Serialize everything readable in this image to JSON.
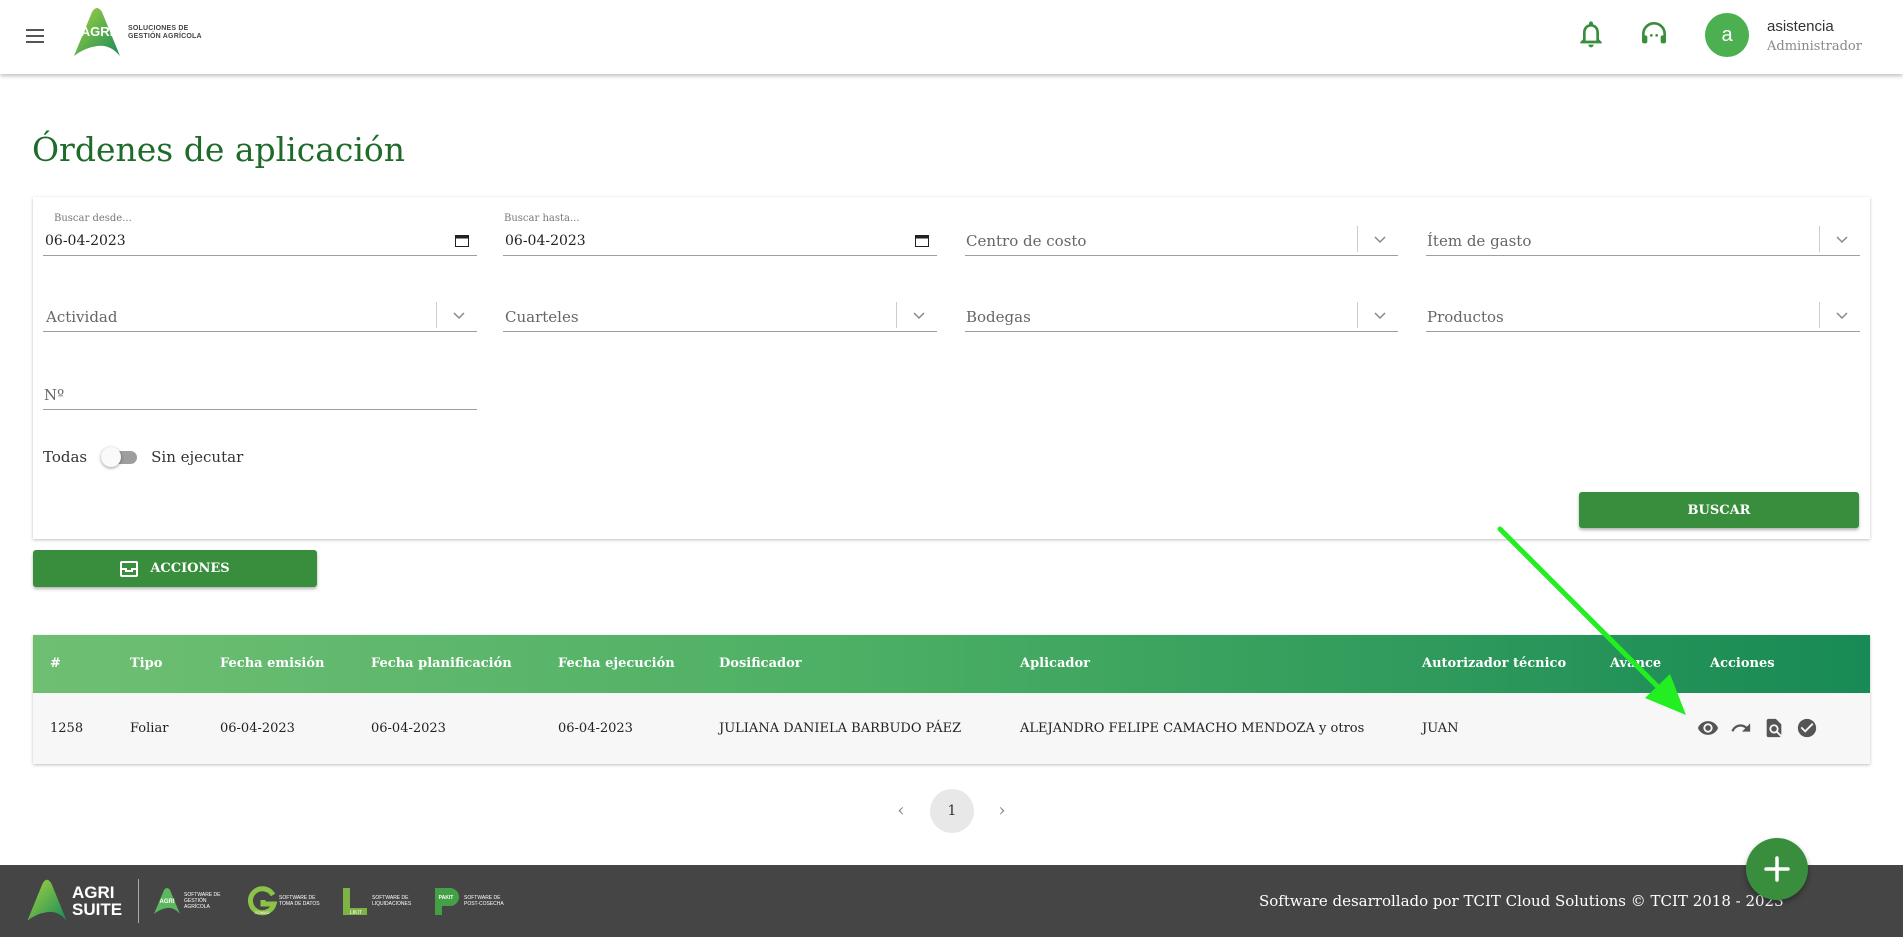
{
  "header": {
    "logo_text": "SOLUCIONES DE GESTIÓN AGRÍCOLA",
    "logo_word": "AGRI",
    "user_initial": "a",
    "user_name": "asistencia",
    "user_role": "Administrador",
    "icons": [
      "menu-icon",
      "bell-icon",
      "support-headset-icon"
    ]
  },
  "page": {
    "title": "Órdenes de aplicación"
  },
  "filters": {
    "desde": {
      "label": "Buscar desde...",
      "value": "06-04-2023"
    },
    "hasta": {
      "label": "Buscar hasta...",
      "value": "06-04-2023"
    },
    "centro_costo": "Centro de costo",
    "item_gasto": "Ítem de gasto",
    "actividad": "Actividad",
    "cuarteles": "Cuarteles",
    "bodegas": "Bodegas",
    "productos": "Productos",
    "numero": "Nº",
    "toggle_left": "Todas",
    "toggle_right": "Sin ejecutar",
    "search_button": "BUSCAR"
  },
  "actions_button": "ACCIONES",
  "table": {
    "headers": [
      "#",
      "Tipo",
      "Fecha emisión",
      "Fecha planificación",
      "Fecha ejecución",
      "Dosificador",
      "Aplicador",
      "Autorizador técnico",
      "Avance",
      "Acciones"
    ],
    "rows": [
      {
        "num": "1258",
        "tipo": "Foliar",
        "emision": "06-04-2023",
        "planificacion": "06-04-2023",
        "ejecucion": "06-04-2023",
        "dosificador": "JULIANA DANIELA BARBUDO PÁEZ",
        "aplicador": "ALEJANDRO FELIPE CAMACHO MENDOZA y otros",
        "autorizador": "JUAN",
        "avance": "",
        "action_icons": [
          "eye-icon",
          "redo-icon",
          "find-in-page-icon",
          "check-circle-icon"
        ]
      }
    ]
  },
  "pagination": {
    "current": "1"
  },
  "footer": {
    "brand": "AGRI SUITE",
    "text": "Software desarrollado por TCIT Cloud Solutions © TCIT 2018 - 2023",
    "sublogos": [
      {
        "word": "AGRI",
        "caption": "SOFTWARE DE GESTIÓN AGRÍCOLA"
      },
      {
        "word": "GOMAD",
        "caption": "SOFTWARE DE TOMA DE DATOS"
      },
      {
        "word": "LIKIT",
        "caption": "SOFTWARE DE LIQUIDACIONES"
      },
      {
        "word": "PAKIT",
        "caption": "SOFTWARE DE POST-COSECHA"
      }
    ]
  },
  "colors": {
    "primary": "#388e3c",
    "title": "#1f6b2a",
    "footer": "#454545",
    "annotation_arrow": "#22ee22"
  }
}
